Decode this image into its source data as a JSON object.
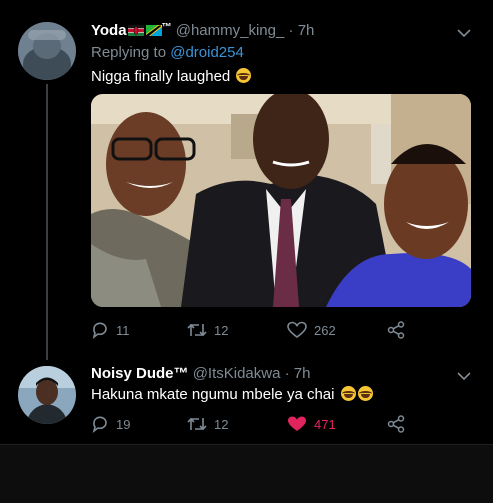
{
  "tweet1": {
    "display_name": "Yoda",
    "trademark": "™",
    "handle": "@hammy_king_",
    "separator": "·",
    "time": "7h",
    "replying_label": "Replying to",
    "replying_handle": "@droid254",
    "text": "Nigga finally laughed",
    "emoji": [
      "face-with-tears-of-joy"
    ],
    "flags": [
      "kenya-flag-icon",
      "tanzania-flag-icon"
    ],
    "actions": {
      "replies": "11",
      "retweets": "12",
      "likes": "262"
    }
  },
  "tweet2": {
    "display_name": "Noisy Dude™",
    "handle": "@ItsKidakwa",
    "separator": "·",
    "time": "7h",
    "text": "Hakuna mkate ngumu mbele ya chai",
    "emoji": [
      "face-with-tears-of-joy",
      "face-with-tears-of-joy"
    ],
    "actions": {
      "replies": "19",
      "retweets": "12",
      "likes": "471",
      "liked": true
    }
  },
  "colors": {
    "background": "#000000",
    "secondary_text": "#7f8b95",
    "mention": "#3b94d9",
    "like_active": "#e0245e"
  }
}
